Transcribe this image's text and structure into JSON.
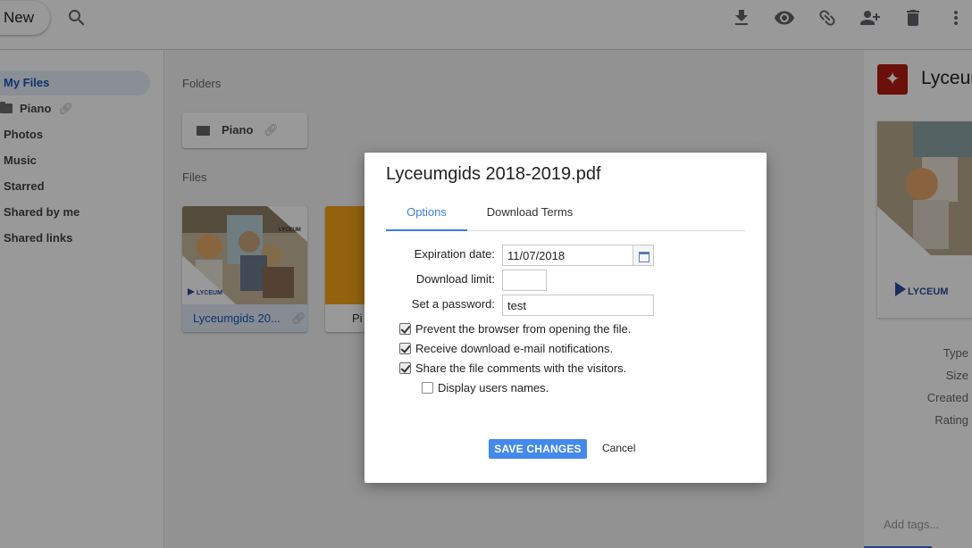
{
  "toolbar": {
    "new_label": "New",
    "icons": [
      "search-icon",
      "download-icon",
      "eye-icon",
      "link-icon",
      "add-user-icon",
      "trash-icon",
      "more-vert-icon"
    ]
  },
  "sidebar": {
    "items": [
      {
        "label": "My Files",
        "active": true
      },
      {
        "label": "Piano",
        "icon": "folder-icon",
        "shared": true
      },
      {
        "label": "Photos"
      },
      {
        "label": "Music"
      },
      {
        "label": "Starred"
      },
      {
        "label": "Shared by me"
      },
      {
        "label": "Shared links"
      }
    ]
  },
  "main": {
    "folders_label": "Folders",
    "folders": [
      {
        "name": "Piano"
      }
    ],
    "files_label": "Files",
    "files": [
      {
        "name": "Lyceumgids 20...",
        "selected": true
      },
      {
        "name": "Pi"
      }
    ]
  },
  "details": {
    "title": "Lyceum",
    "meta_labels": [
      "Type",
      "Size",
      "Created",
      "Rating"
    ],
    "tags_placeholder": "Add tags..."
  },
  "dialog": {
    "title": "Lyceumgids 2018-2019.pdf",
    "tabs": [
      {
        "label": "Options",
        "active": true
      },
      {
        "label": "Download Terms",
        "active": false
      }
    ],
    "expiration_label": "Expiration date:",
    "expiration_value": "11/07/2018",
    "download_limit_label": "Download limit:",
    "download_limit_value": "",
    "password_label": "Set a password:",
    "password_value": "test",
    "checkboxes": [
      {
        "label": "Prevent the browser from opening the file.",
        "checked": true
      },
      {
        "label": "Receive download e-mail notifications.",
        "checked": true
      },
      {
        "label": "Share the file comments with the visitors.",
        "checked": true
      },
      {
        "label": "Display users names.",
        "checked": false
      }
    ],
    "save_label": "SAVE CHANGES",
    "cancel_label": "Cancel"
  },
  "colors": {
    "accent": "#3b7ee0",
    "save_button": "#4489ec",
    "pdf_red": "#b11a0f",
    "selected_link": "#1a56b8"
  }
}
